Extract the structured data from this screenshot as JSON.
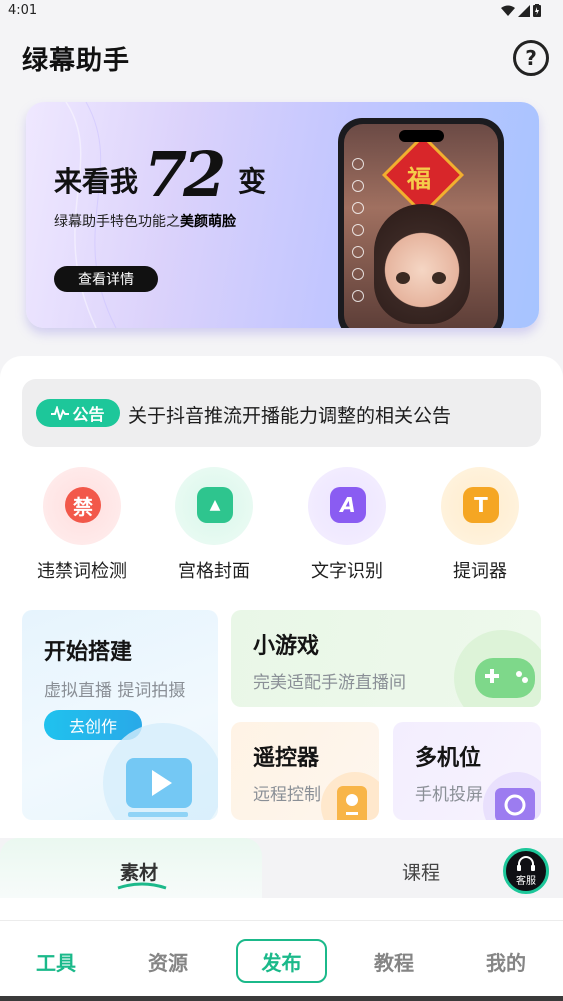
{
  "status_bar": {
    "time": "4:01"
  },
  "header": {
    "title": "绿幕助手",
    "help_symbol": "?"
  },
  "banner": {
    "title_prefix": "来看我",
    "title_big": "72",
    "title_suffix": "变",
    "subtitle_prefix": "绿幕助手特色功能之",
    "subtitle_bold": "美颜萌脸",
    "button_label": "查看详情",
    "phone_sign": "福"
  },
  "notice": {
    "badge_label": "公告",
    "text": "关于抖音推流开播能力调整的相关公告"
  },
  "tools": [
    {
      "label": "违禁词检测",
      "icon": "forbidden-icon",
      "glyph": "禁"
    },
    {
      "label": "宫格封面",
      "icon": "image-grid-icon",
      "glyph": "▲"
    },
    {
      "label": "文字识别",
      "icon": "text-recognition-icon",
      "glyph": "A"
    },
    {
      "label": "提词器",
      "icon": "teleprompter-icon",
      "glyph": "T"
    }
  ],
  "cards": {
    "build": {
      "title": "开始搭建",
      "subtitle": "虚拟直播 提词拍摄",
      "button": "去创作"
    },
    "game": {
      "title": "小游戏",
      "subtitle": "完美适配手游直播间"
    },
    "remote": {
      "title": "遥控器",
      "subtitle": "远程控制"
    },
    "multicam": {
      "title": "多机位",
      "subtitle": "手机投屏"
    }
  },
  "content_tabs": {
    "tabs": [
      "素材",
      "课程"
    ],
    "active": "素材",
    "service_label": "客服"
  },
  "bottom_nav": {
    "items": [
      "工具",
      "资源",
      "发布",
      "教程",
      "我的"
    ],
    "active": "工具"
  },
  "colors": {
    "accent": "#1bb98a",
    "notice_badge": "#1dc79a",
    "create_button": "#20c2ee"
  }
}
